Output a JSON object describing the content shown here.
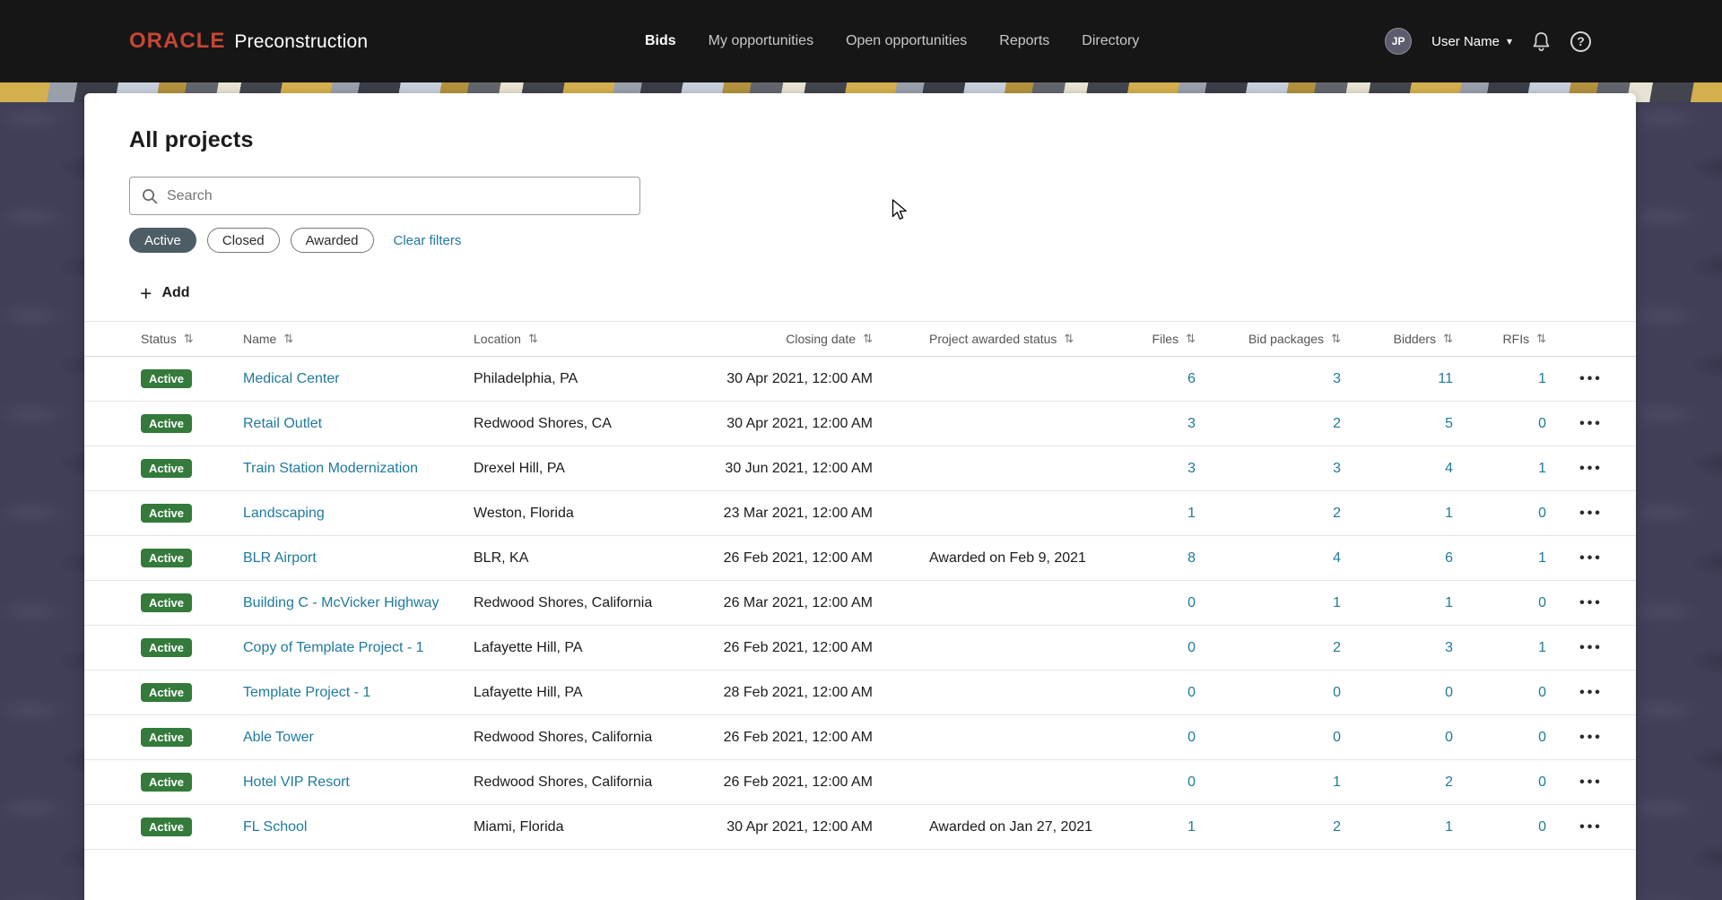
{
  "brand": {
    "logo": "ORACLE",
    "product": "Preconstruction"
  },
  "nav": {
    "items": [
      {
        "label": "Bids",
        "active": true
      },
      {
        "label": "My opportunities",
        "active": false
      },
      {
        "label": "Open opportunities",
        "active": false
      },
      {
        "label": "Reports",
        "active": false
      },
      {
        "label": "Directory",
        "active": false
      }
    ]
  },
  "user": {
    "initials": "JP",
    "name": "User Name"
  },
  "page": {
    "title": "All projects"
  },
  "search": {
    "placeholder": "Search"
  },
  "filters": {
    "chips": [
      {
        "label": "Active",
        "selected": true
      },
      {
        "label": "Closed",
        "selected": false
      },
      {
        "label": "Awarded",
        "selected": false
      }
    ],
    "clear_label": "Clear filters"
  },
  "toolbar": {
    "add_label": "Add"
  },
  "icons": {
    "sort": "⇅",
    "caret_down": "▾",
    "plus": "+",
    "overflow": "•••",
    "help": "?"
  },
  "table": {
    "columns": [
      {
        "label": "Status"
      },
      {
        "label": "Name"
      },
      {
        "label": "Location"
      },
      {
        "label": "Closing date"
      },
      {
        "label": "Project awarded status"
      },
      {
        "label": "Files"
      },
      {
        "label": "Bid packages"
      },
      {
        "label": "Bidders"
      },
      {
        "label": "RFIs"
      }
    ],
    "rows": [
      {
        "status": "Active",
        "name": "Medical Center",
        "location": "Philadelphia, PA",
        "closing_date": "30 Apr 2021, 12:00 AM",
        "awarded_status": "",
        "files": "6",
        "bid_packages": "3",
        "bidders": "11",
        "rfis": "1"
      },
      {
        "status": "Active",
        "name": "Retail Outlet",
        "location": "Redwood Shores, CA",
        "closing_date": "30 Apr 2021, 12:00 AM",
        "awarded_status": "",
        "files": "3",
        "bid_packages": "2",
        "bidders": "5",
        "rfis": "0"
      },
      {
        "status": "Active",
        "name": "Train Station Modernization",
        "location": "Drexel Hill, PA",
        "closing_date": "30 Jun 2021, 12:00 AM",
        "awarded_status": "",
        "files": "3",
        "bid_packages": "3",
        "bidders": "4",
        "rfis": "1"
      },
      {
        "status": "Active",
        "name": "Landscaping",
        "location": "Weston, Florida",
        "closing_date": "23 Mar 2021, 12:00 AM",
        "awarded_status": "",
        "files": "1",
        "bid_packages": "2",
        "bidders": "1",
        "rfis": "0"
      },
      {
        "status": "Active",
        "name": "BLR Airport",
        "location": "BLR, KA",
        "closing_date": "26 Feb 2021, 12:00 AM",
        "awarded_status": "Awarded on Feb 9, 2021",
        "files": "8",
        "bid_packages": "4",
        "bidders": "6",
        "rfis": "1"
      },
      {
        "status": "Active",
        "name": "Building C - McVicker Highway",
        "location": "Redwood Shores, California",
        "closing_date": "26 Mar 2021, 12:00 AM",
        "awarded_status": "",
        "files": "0",
        "bid_packages": "1",
        "bidders": "1",
        "rfis": "0"
      },
      {
        "status": "Active",
        "name": "Copy of Template Project - 1",
        "location": "Lafayette Hill, PA",
        "closing_date": "26 Feb 2021, 12:00 AM",
        "awarded_status": "",
        "files": "0",
        "bid_packages": "2",
        "bidders": "3",
        "rfis": "1"
      },
      {
        "status": "Active",
        "name": "Template Project - 1",
        "location": "Lafayette Hill, PA",
        "closing_date": "28 Feb 2021, 12:00 AM",
        "awarded_status": "",
        "files": "0",
        "bid_packages": "0",
        "bidders": "0",
        "rfis": "0"
      },
      {
        "status": "Active",
        "name": "Able Tower",
        "location": "Redwood Shores, California",
        "closing_date": "26 Feb 2021, 12:00 AM",
        "awarded_status": "",
        "files": "0",
        "bid_packages": "0",
        "bidders": "0",
        "rfis": "0"
      },
      {
        "status": "Active",
        "name": "Hotel VIP Resort",
        "location": "Redwood Shores, California",
        "closing_date": "26 Feb 2021, 12:00 AM",
        "awarded_status": "",
        "files": "0",
        "bid_packages": "1",
        "bidders": "2",
        "rfis": "0"
      },
      {
        "status": "Active",
        "name": "FL School",
        "location": "Miami, Florida",
        "closing_date": "30 Apr 2021, 12:00 AM",
        "awarded_status": "Awarded on Jan 27, 2021",
        "files": "1",
        "bid_packages": "2",
        "bidders": "1",
        "rfis": "0"
      }
    ]
  },
  "colors": {
    "brand_red": "#C74634",
    "navbar_bg": "#161616",
    "page_bg": "#3F3F59",
    "link": "#1F7A9D",
    "badge_green": "#347A3B",
    "chip_selected_bg": "#4D5D66"
  }
}
